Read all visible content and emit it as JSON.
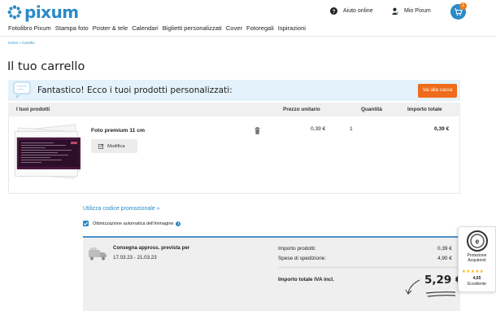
{
  "header": {
    "logo_text": "pixum",
    "help_label": "Aiuto online",
    "account_label": "Mio Pixum",
    "cart_count": "1",
    "brand_color": "#2c8ac6",
    "accent_color": "#ef6c1a"
  },
  "nav": {
    "items": [
      "Fotolibro Pixum",
      "Stampa foto",
      "Poster & tele",
      "Calendari",
      "Biglietti personalizzati",
      "Cover",
      "Fotoregali",
      "Ispirazioni"
    ]
  },
  "breadcrumb": "Home » Carrello",
  "page_title": "Il tuo carrello",
  "banner": {
    "text": "Fantastico! Ecco i tuoi prodotti personalizzati:",
    "checkout_label": "Vai alla cassa"
  },
  "table": {
    "headers": {
      "products": "I tuoi prodotti",
      "unit_price": "Prezzo unitario",
      "quantity": "Quantità",
      "total": "Importo totale"
    },
    "rows": [
      {
        "name": "Foto premium 11 cm",
        "edit_label": "Modifica",
        "unit_price": "0,39 €",
        "quantity": "1",
        "total": "0,39 €"
      }
    ]
  },
  "promo_link": "Utilizza codice promozionale »",
  "optimization": {
    "label": "Ottimizzazione automatica dell'immagine",
    "checked": true
  },
  "summary": {
    "delivery_title": "Consegna appross. prevista per",
    "delivery_dates": "17.03.23 - 21.03.23",
    "products_label": "Importo prodotti:",
    "products_value": "0,39 €",
    "shipping_label": "Spese di spedizione:",
    "shipping_value": "4,90 €",
    "total_label": "Importo totale IVA incl.",
    "total_value": "5,29 €"
  },
  "trust_badge": {
    "line1": "Protezione",
    "line2": "Acquirenti",
    "rating": "4,65",
    "rating_word": "Eccellente"
  }
}
